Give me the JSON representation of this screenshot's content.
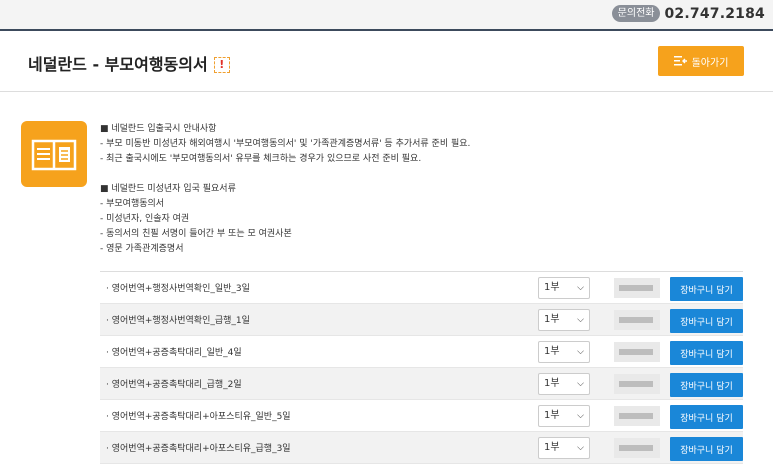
{
  "topbar": {
    "phone_badge": "문의전화",
    "phone_number": "02.747.2184"
  },
  "header": {
    "title": "네덜란드 - 부모여행동의서",
    "warn_icon": "!",
    "back_label": "돌아가기"
  },
  "info": {
    "section1_title": "■ 네덜란드 입출국시 안내사항",
    "section1_lines": [
      "- 부모 미동반 미성년자 해외여행시 '부모여행동의서' 및 '가족관계증명서류' 등 추가서류 준비 필요.",
      "- 최근 출국시에도 '부모여행동의서' 유무를 체크하는 경우가 있으므로 사전 준비 필요."
    ],
    "section2_title": "■ 네덜란드 미성년자 입국 필요서류",
    "section2_lines": [
      "- 부모여행동의서",
      "- 미성년자, 인솔자 여권",
      "- 동의서의 친필 서명이 들어간 부 또는 모 여권사본",
      "- 영문 가족관계증명서"
    ]
  },
  "products": [
    {
      "label": "영어번역+행정사번역확인_일반_3일",
      "qty": "1부",
      "cart_label": "장바구니 담기"
    },
    {
      "label": "영어번역+행정사번역확인_급행_1일",
      "qty": "1부",
      "cart_label": "장바구니 담기"
    },
    {
      "label": "영어번역+공증촉탁대리_일반_4일",
      "qty": "1부",
      "cart_label": "장바구니 담기"
    },
    {
      "label": "영어번역+공증촉탁대리_급행_2일",
      "qty": "1부",
      "cart_label": "장바구니 담기"
    },
    {
      "label": "영어번역+공증촉탁대리+아포스티유_일반_5일",
      "qty": "1부",
      "cart_label": "장바구니 담기"
    },
    {
      "label": "영어번역+공증촉탁대리+아포스티유_급행_3일",
      "qty": "1부",
      "cart_label": "장바구니 담기"
    }
  ],
  "colors": {
    "accent": "#f6a21c",
    "cart_button": "#1a87d8"
  }
}
